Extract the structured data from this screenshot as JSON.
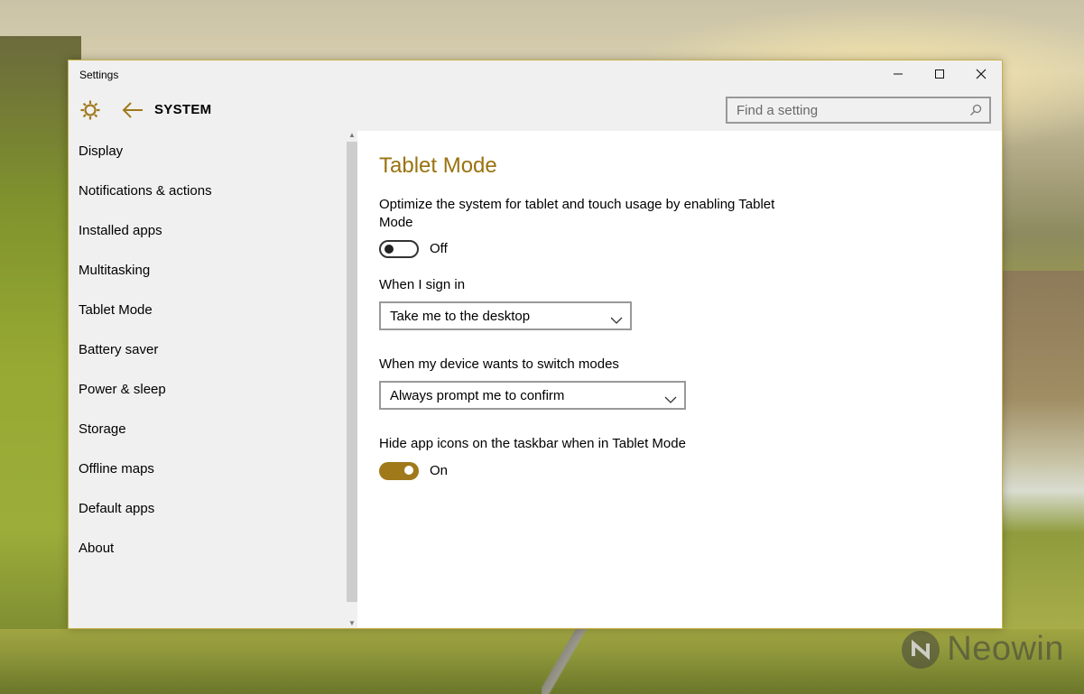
{
  "window": {
    "title": "Settings",
    "controls": {
      "minimize": "—",
      "maximize": "☐",
      "close": "✕"
    }
  },
  "header": {
    "section": "SYSTEM",
    "search_placeholder": "Find a setting"
  },
  "sidebar": {
    "items": [
      {
        "label": "Display"
      },
      {
        "label": "Notifications & actions"
      },
      {
        "label": "Installed apps"
      },
      {
        "label": "Multitasking"
      },
      {
        "label": "Tablet Mode"
      },
      {
        "label": "Battery saver"
      },
      {
        "label": "Power & sleep"
      },
      {
        "label": "Storage"
      },
      {
        "label": "Offline maps"
      },
      {
        "label": "Default apps"
      },
      {
        "label": "About"
      }
    ]
  },
  "main": {
    "title": "Tablet Mode",
    "tablet_mode_description": "Optimize the system for tablet and touch usage by enabling Tablet Mode",
    "tablet_mode_toggle": {
      "state": "Off"
    },
    "sign_in_label": "When I sign in",
    "sign_in_value": "Take me to the desktop",
    "switch_modes_label": "When my device wants to switch modes",
    "switch_modes_value": "Always prompt me to confirm",
    "hide_icons_label": "Hide app icons on the taskbar when in Tablet Mode",
    "hide_icons_toggle": {
      "state": "On"
    }
  },
  "desktop": {
    "watermark": "Neowin"
  },
  "colors": {
    "accent": "#a0791a",
    "title_accent": "#9a7310",
    "chrome_bg": "#f0f0f0"
  }
}
